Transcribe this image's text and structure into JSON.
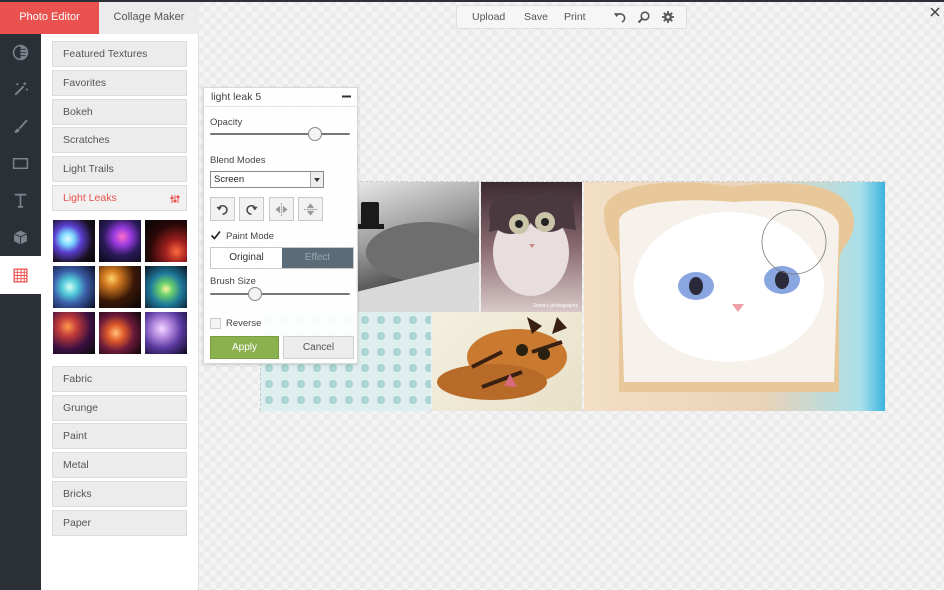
{
  "tabs": {
    "photo_editor": "Photo Editor",
    "collage_maker": "Collage Maker"
  },
  "toolbar": {
    "upload": "Upload",
    "save": "Save",
    "print": "Print"
  },
  "rail": [
    {
      "name": "adjust-icon"
    },
    {
      "name": "magic-wand-icon"
    },
    {
      "name": "brush-icon"
    },
    {
      "name": "frame-icon"
    },
    {
      "name": "text-icon"
    },
    {
      "name": "cube-icon"
    },
    {
      "name": "textures-icon",
      "active": true
    }
  ],
  "categories_top": [
    "Featured Textures",
    "Favorites",
    "Bokeh",
    "Scratches",
    "Light Trails",
    "Light Leaks"
  ],
  "active_category": "Light Leaks",
  "categories_bottom": [
    "Fabric",
    "Grunge",
    "Paint",
    "Metal",
    "Bricks",
    "Paper"
  ],
  "panel": {
    "title": "light leak 5",
    "opacity_label": "Opacity",
    "opacity_value": 0.78,
    "blend_label": "Blend Modes",
    "blend_value": "Screen",
    "paint_mode_label": "Paint Mode",
    "paint_mode_checked": true,
    "toggle_original": "Original",
    "toggle_effect": "Effect",
    "brush_label": "Brush Size",
    "brush_value": 0.3,
    "reverse_label": "Reverse",
    "apply": "Apply",
    "cancel": "Cancel"
  },
  "photo_caption": "Sonia's photography",
  "colors": {
    "accent": "#e9524f",
    "rail": "#2b2f36",
    "apply": "#8bb04e"
  }
}
